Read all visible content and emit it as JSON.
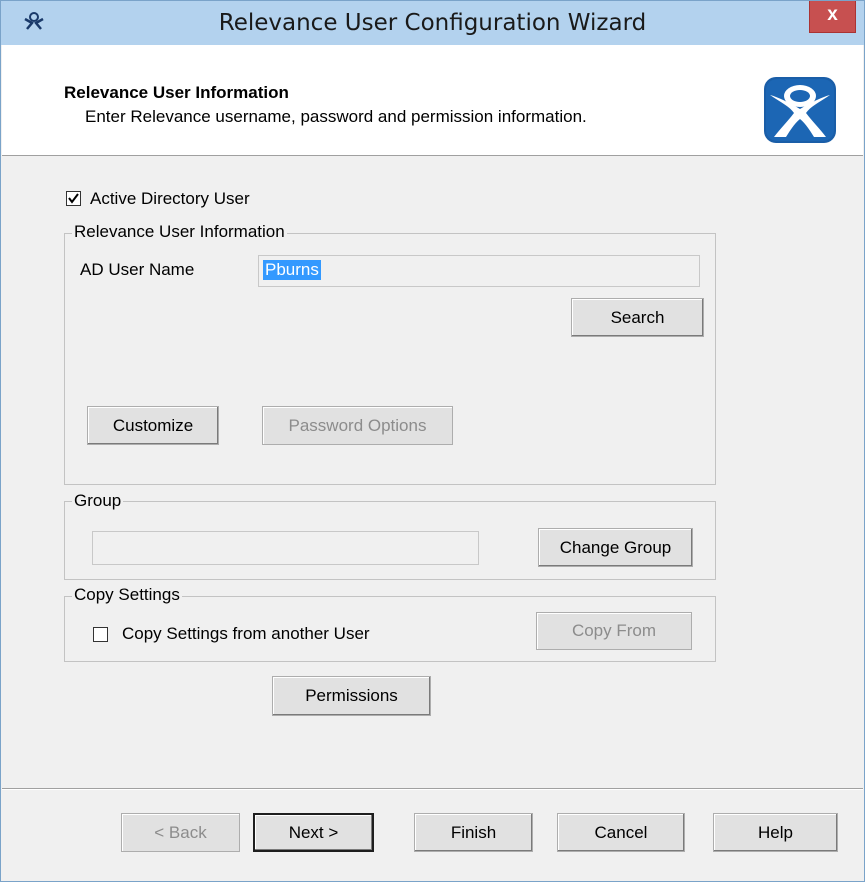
{
  "window": {
    "title": "Relevance User Configuration Wizard",
    "close_label": "x"
  },
  "header": {
    "title": "Relevance User Information",
    "subtitle": "Enter Relevance username, password and permission information."
  },
  "active_directory": {
    "label": "Active Directory User",
    "checked": true
  },
  "user_group": {
    "legend": "Relevance User Information",
    "ad_user_label": "AD User Name",
    "ad_user_value": "Pburns",
    "search_label": "Search",
    "customize_label": "Customize",
    "password_options_label": "Password Options"
  },
  "group": {
    "legend": "Group",
    "value": "",
    "change_group_label": "Change Group"
  },
  "copy_settings": {
    "legend": "Copy Settings",
    "checkbox_label": "Copy Settings from another User",
    "checked": false,
    "copy_from_label": "Copy From"
  },
  "permissions_label": "Permissions",
  "footer": {
    "back_label": "< Back",
    "next_label": "Next >",
    "finish_label": "Finish",
    "cancel_label": "Cancel",
    "help_label": "Help"
  },
  "icons": {
    "title_icon": "user-silhouette-icon",
    "logo": "thinmanager-logo-icon",
    "close": "close-icon"
  },
  "colors": {
    "titlebar": "#b3d2ee",
    "close_button": "#c75050",
    "selection": "#3399ff",
    "logo_blue": "#1a5ea8"
  }
}
